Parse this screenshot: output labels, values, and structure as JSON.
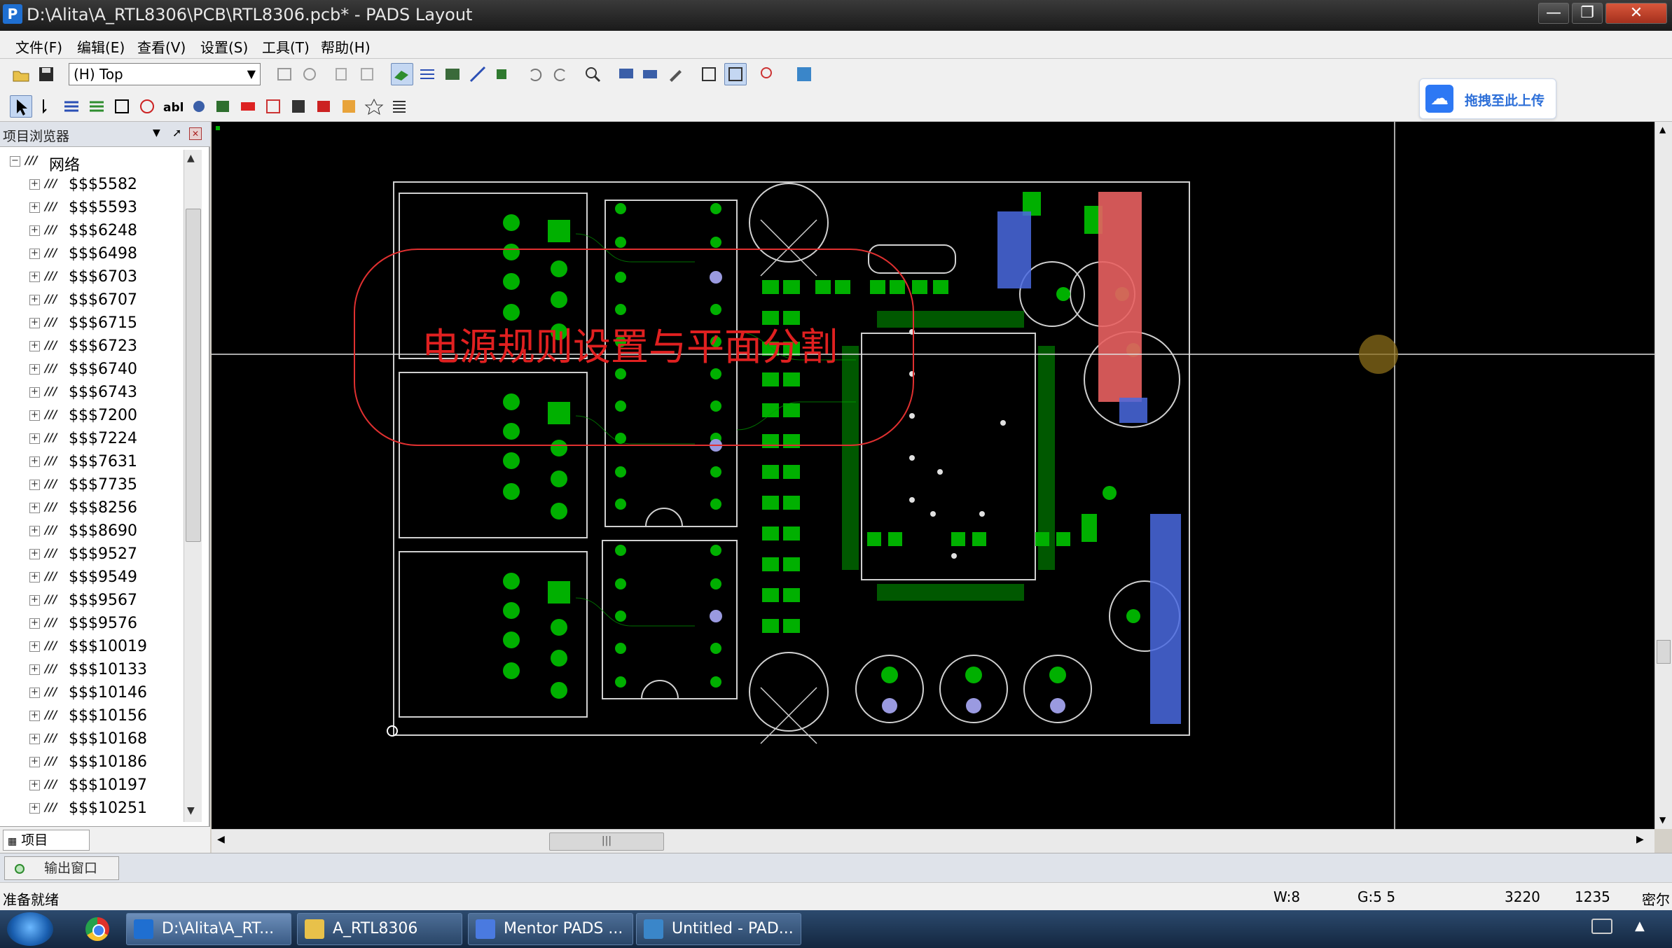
{
  "window": {
    "title": "D:\\Alita\\A_RTL8306\\PCB\\RTL8306.pcb* - PADS Layout",
    "icon": "P"
  },
  "menu": [
    "文件(F)",
    "编辑(E)",
    "查看(V)",
    "设置(S)",
    "工具(T)",
    "帮助(H)"
  ],
  "toolbar": {
    "layer": "(H) Top",
    "upload": "拖拽至此上传"
  },
  "project_browser": {
    "title": "项目浏览器",
    "root": "网络",
    "nets": [
      "$$$5582",
      "$$$5593",
      "$$$6248",
      "$$$6498",
      "$$$6703",
      "$$$6707",
      "$$$6715",
      "$$$6723",
      "$$$6740",
      "$$$6743",
      "$$$7200",
      "$$$7224",
      "$$$7631",
      "$$$7735",
      "$$$8256",
      "$$$8690",
      "$$$9527",
      "$$$9549",
      "$$$9567",
      "$$$9576",
      "$$$10019",
      "$$$10133",
      "$$$10146",
      "$$$10156",
      "$$$10168",
      "$$$10186",
      "$$$10197",
      "$$$10251"
    ],
    "tab": "项目"
  },
  "overlay": {
    "title": "电源规则设置与平面分割",
    "key": "Ctrl"
  },
  "output": {
    "tab": "输出窗口"
  },
  "status": {
    "ready": "准备就绪",
    "width": "W:8",
    "grid": "G:5 5",
    "x": "3220",
    "y": "1235",
    "unit": "密尔"
  },
  "taskbar": {
    "items": [
      "D:\\Alita\\A_RT...",
      "A_RTL8306",
      "Mentor PADS ...",
      "Untitled - PAD..."
    ]
  },
  "colors": {
    "board_bg": "#000000",
    "pad": "#00a000",
    "outline": "#d0d0d0",
    "highlight_red": "#e03030",
    "highlight_blue": "#4a7ae0"
  }
}
